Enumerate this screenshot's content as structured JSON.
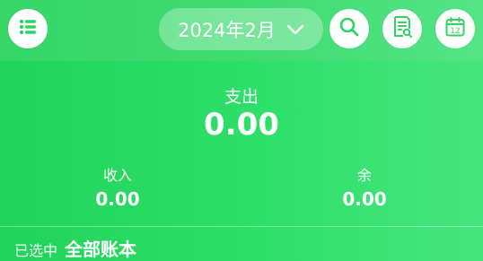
{
  "header": {
    "month_label": "2024年2月",
    "icons": {
      "menu": "list-icon",
      "dropdown": "chevron-down-icon",
      "search": "search-icon",
      "bill": "bill-search-icon",
      "calendar": "calendar-icon"
    },
    "calendar_day": "12"
  },
  "summary": {
    "expense_label": "支出",
    "expense_value": "0.00",
    "income_label": "收入",
    "income_value": "0.00",
    "balance_label": "余",
    "balance_value": "0.00"
  },
  "selection": {
    "label": "已选中",
    "value": "全部账本"
  },
  "colors": {
    "accent_green": "#2ee06a",
    "icon_green": "#2fd463",
    "white": "#ffffff"
  }
}
